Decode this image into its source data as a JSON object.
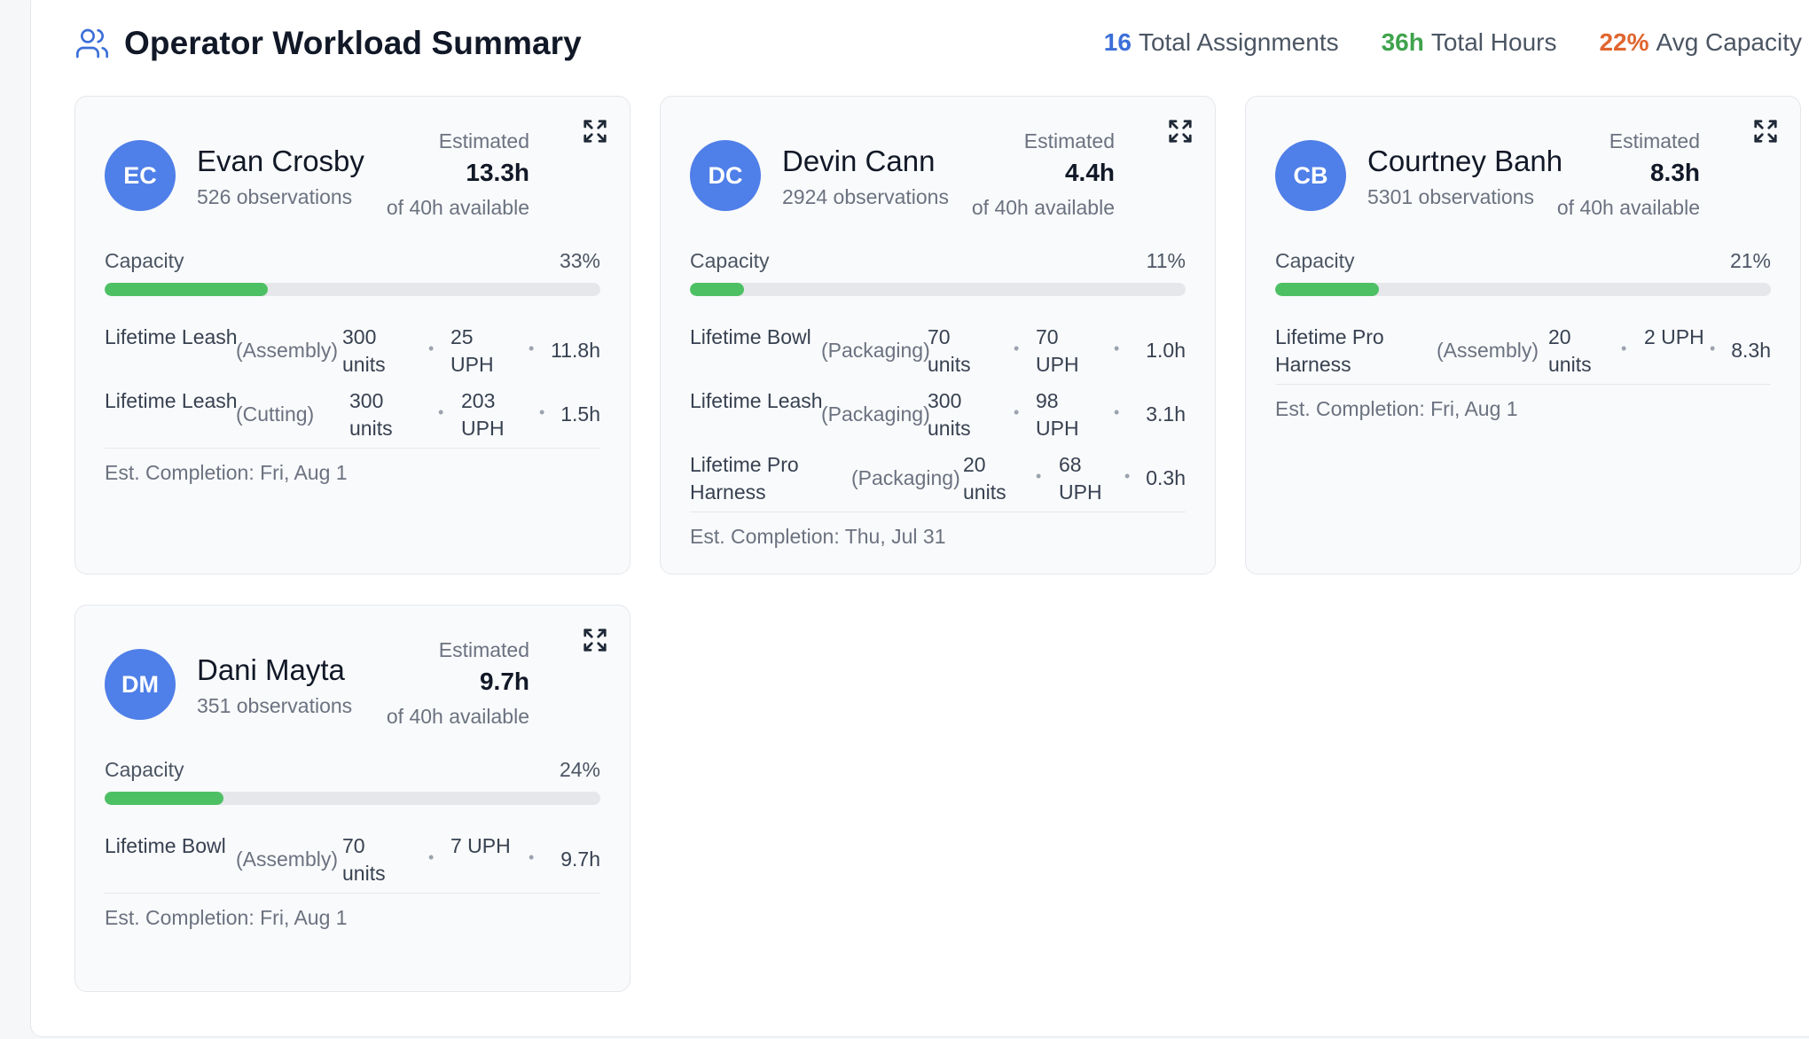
{
  "header": {
    "title": "Operator Workload Summary",
    "stats": [
      {
        "value": "16",
        "label": "Total Assignments",
        "color": "#3b6fd8"
      },
      {
        "value": "36h",
        "label": "Total Hours",
        "color": "#3fa34d"
      },
      {
        "value": "22%",
        "label": "Avg Capacity",
        "color": "#e0662f"
      }
    ]
  },
  "operators": [
    {
      "initials": "EC",
      "name": "Evan Crosby",
      "observations": "526 observations",
      "estimated_label": "Estimated",
      "estimated_hours": "13.3h",
      "available": "of 40h available",
      "capacity_label": "Capacity",
      "capacity_pct": "33%",
      "capacity_fraction": 0.33,
      "tasks": [
        {
          "name": "Lifetime Leash",
          "process": "(Assembly)",
          "units": "300 units",
          "uph": "25 UPH",
          "hours": "11.8h"
        },
        {
          "name": "Lifetime Leash",
          "process": "(Cutting)",
          "units": "300 units",
          "uph": "203 UPH",
          "hours": "1.5h"
        }
      ],
      "completion": "Est. Completion: Fri, Aug 1"
    },
    {
      "initials": "DC",
      "name": "Devin Cann",
      "observations": "2924 observations",
      "estimated_label": "Estimated",
      "estimated_hours": "4.4h",
      "available": "of 40h available",
      "capacity_label": "Capacity",
      "capacity_pct": "11%",
      "capacity_fraction": 0.11,
      "tasks": [
        {
          "name": "Lifetime Bowl",
          "process": "(Packaging)",
          "units": "70 units",
          "uph": "70 UPH",
          "hours": "1.0h"
        },
        {
          "name": "Lifetime Leash",
          "process": "(Packaging)",
          "units": "300 units",
          "uph": "98 UPH",
          "hours": "3.1h"
        },
        {
          "name": "Lifetime Pro Harness",
          "process": "(Packaging)",
          "units": "20 units",
          "uph": "68 UPH",
          "hours": "0.3h"
        }
      ],
      "completion": "Est. Completion: Thu, Jul 31"
    },
    {
      "initials": "CB",
      "name": "Courtney Banh",
      "observations": "5301 observations",
      "estimated_label": "Estimated",
      "estimated_hours": "8.3h",
      "available": "of 40h available",
      "capacity_label": "Capacity",
      "capacity_pct": "21%",
      "capacity_fraction": 0.21,
      "tasks": [
        {
          "name": "Lifetime Pro Harness",
          "process": "(Assembly)",
          "units": "20 units",
          "uph": "2 UPH",
          "hours": "8.3h"
        }
      ],
      "completion": "Est. Completion: Fri, Aug 1"
    },
    {
      "initials": "DM",
      "name": "Dani Mayta",
      "observations": "351 observations",
      "estimated_label": "Estimated",
      "estimated_hours": "9.7h",
      "available": "of 40h available",
      "capacity_label": "Capacity",
      "capacity_pct": "24%",
      "capacity_fraction": 0.24,
      "tasks": [
        {
          "name": "Lifetime Bowl",
          "process": "(Assembly)",
          "units": "70 units",
          "uph": "7 UPH",
          "hours": "9.7h"
        }
      ],
      "completion": "Est. Completion: Fri, Aug 1"
    }
  ],
  "icons": {
    "header": "users-icon",
    "expand": "expand-icon"
  }
}
